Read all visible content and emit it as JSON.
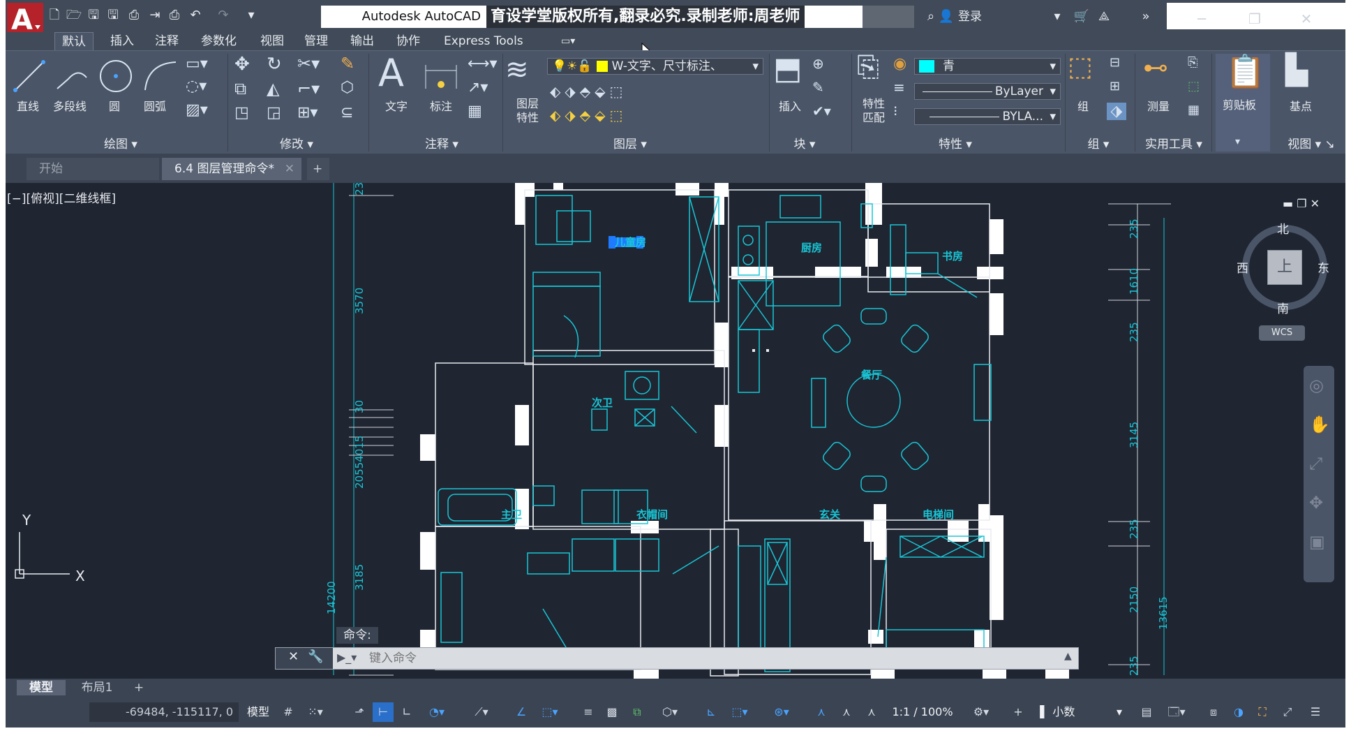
{
  "app": {
    "title": "Autodesk AutoCAD",
    "overlay_text": "育设学堂版权所有,翻录必究.录制老师:周老师",
    "login": "登录"
  },
  "menu_tabs": [
    "默认",
    "插入",
    "注释",
    "参数化",
    "视图",
    "管理",
    "输出",
    "协作",
    "Express Tools"
  ],
  "ribbon": {
    "draw": {
      "line": "直线",
      "polyline": "多段线",
      "circle": "圆",
      "arc": "圆弧",
      "title": "绘图"
    },
    "modify": {
      "title": "修改"
    },
    "annotation": {
      "text": "文字",
      "dimension": "标注",
      "title": "注释"
    },
    "layers": {
      "layer_props": "图层特性",
      "current_layer": "W-文字、尺寸标注、",
      "title": "图层"
    },
    "block": {
      "insert": "插入",
      "title": "块"
    },
    "properties": {
      "match": "特性匹配",
      "color": "青",
      "linetype": "ByLayer",
      "lineweight": "BYLA...",
      "title": "特性"
    },
    "groups": {
      "group": "组",
      "title": "组"
    },
    "utilities": {
      "measure": "测量",
      "title": "实用工具"
    },
    "clipboard": {
      "paste": "剪贴板"
    },
    "view": {
      "base": "基点",
      "title": "视图"
    }
  },
  "doc_tabs": [
    {
      "label": "开始"
    },
    {
      "label": "6.4 图层管理命令*"
    }
  ],
  "viewport": {
    "label": "[−][俯视][二维线框]",
    "viewcube": {
      "north": "北",
      "south": "南",
      "east": "东",
      "west": "西",
      "top": "上",
      "wcs": "WCS"
    }
  },
  "drawing": {
    "rooms": [
      "儿童房",
      "厨房",
      "书房",
      "餐厅",
      "次卫",
      "主卫",
      "衣帽间",
      "玄关",
      "电梯间"
    ],
    "dims_left": [
      "23",
      "3570",
      "30",
      "20554015",
      "3185",
      "14200"
    ],
    "dims_right": [
      "235",
      "1610",
      "235",
      "3145",
      "235",
      "2150",
      "235",
      "13615"
    ]
  },
  "command": {
    "label": "命令:",
    "placeholder": "键入命令"
  },
  "layout_tabs": [
    "模型",
    "布局1"
  ],
  "status": {
    "coords": "-69484, -115117, 0",
    "model": "模型",
    "scale": "1:1 / 100%",
    "units": "小数"
  }
}
